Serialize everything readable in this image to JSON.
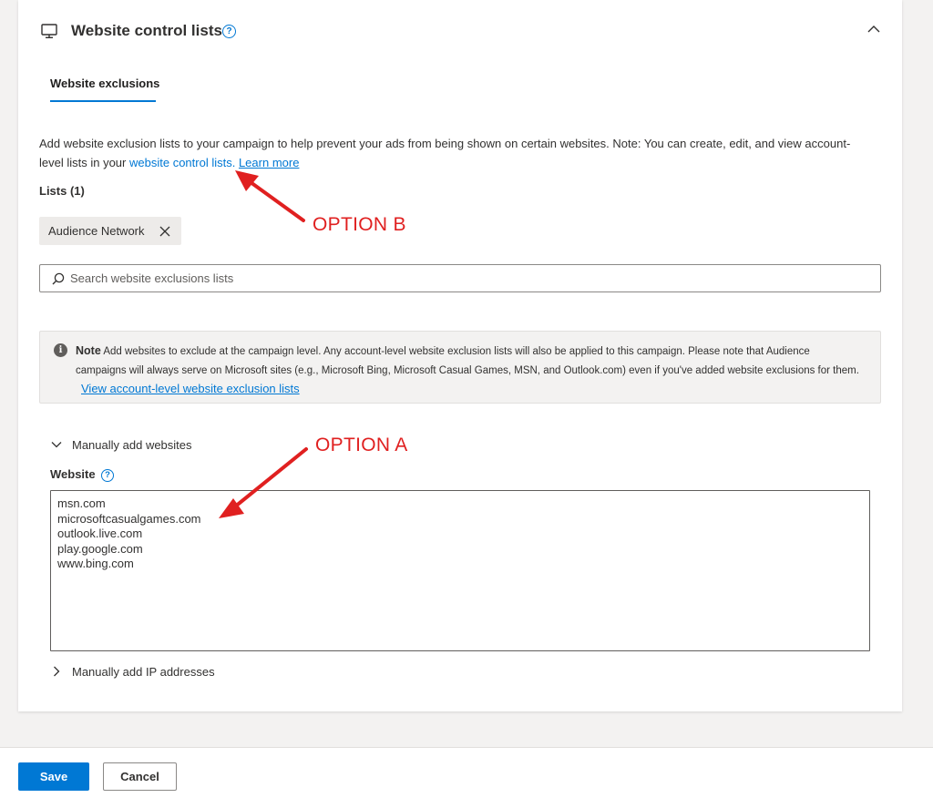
{
  "section": {
    "title": "Website control lists",
    "help_glyph": "?",
    "icon": "monitor-icon",
    "collapse_icon": "chevron-up-icon"
  },
  "tabs": [
    {
      "label": "Website exclusions",
      "selected": true
    }
  ],
  "description": {
    "text": "Add website exclusion lists to your campaign to help prevent your ads from being shown on certain websites. Note: You can create, edit, and view account-level lists in your",
    "link_label": "website control lists.",
    "learn_more_label": "Learn more"
  },
  "lists": {
    "label": "Lists (1)",
    "chips": [
      {
        "label": "Audience Network"
      }
    ]
  },
  "search": {
    "placeholder": "Search website exclusions lists",
    "value": ""
  },
  "note": {
    "icon_glyph": "i",
    "title": "Note",
    "text": "Add websites to exclude at the campaign level. Any account-level website exclusion lists will also be applied to this campaign. Please note that Audience campaigns will always serve on Microsoft sites (e.g., Microsoft Bing, Microsoft Casual Games, MSN, and Outlook.com) even if you've added website exclusions for them.",
    "link_label": "View account-level website exclusion lists"
  },
  "manual_websites": {
    "label": "Manually add websites",
    "expanded": true,
    "field_label": "Website",
    "help_glyph": "?",
    "value": "msn.com\nmicrosoftcasualgames.com\noutlook.live.com\nplay.google.com\nwww.bing.com"
  },
  "manual_ip": {
    "label": "Manually add IP addresses",
    "expanded": false
  },
  "footer": {
    "save_label": "Save",
    "cancel_label": "Cancel"
  },
  "annotations": {
    "option_b": "OPTION B",
    "option_a": "OPTION A",
    "color": "#e02020"
  },
  "colors": {
    "accent": "#0078d4",
    "page_background": "#f3f2f1"
  }
}
